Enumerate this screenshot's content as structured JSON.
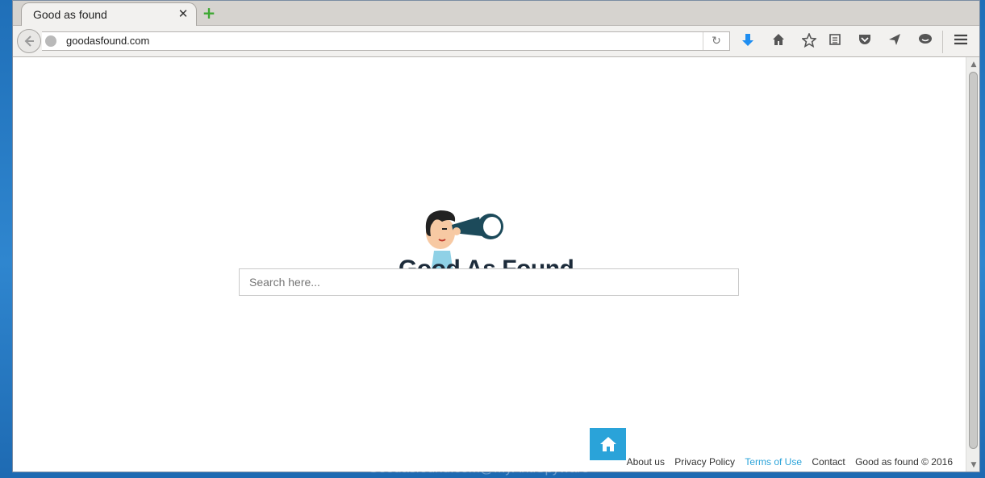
{
  "tab": {
    "title": "Good as found"
  },
  "navbar": {
    "url": "goodasfound.com"
  },
  "page": {
    "search_placeholder": "Search here...",
    "logo_text": "Good As Found"
  },
  "footer": {
    "links": [
      "About us",
      "Privacy Policy",
      "Terms of Use",
      "Contact"
    ],
    "copyright": "Good as found © 2016"
  },
  "watermark": "Goodasfound.com@MyAntiSpyware",
  "colors": {
    "accent": "#2aa3d9",
    "download": "#1f8ef1"
  }
}
